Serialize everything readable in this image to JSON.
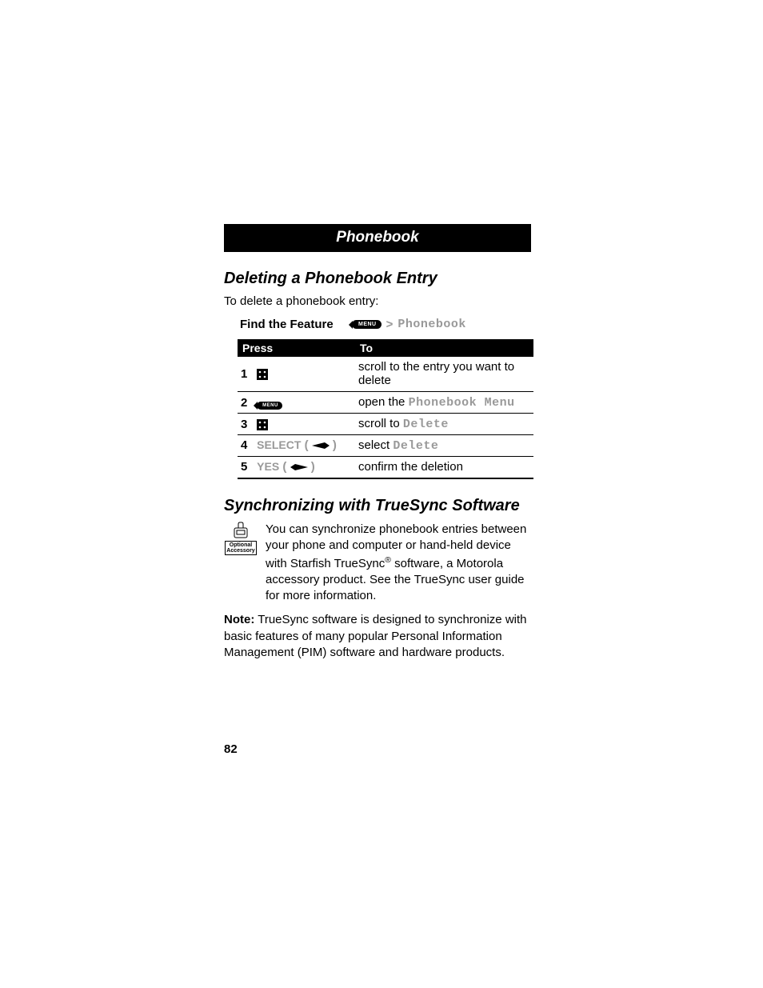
{
  "title_bar": "Phonebook",
  "section1": {
    "heading": "Deleting a Phonebook Entry",
    "intro": "To delete a phonebook entry:",
    "feature_label": "Find the Feature",
    "feature_key": "MENU",
    "feature_gt": ">",
    "feature_target": "Phonebook"
  },
  "table": {
    "headers": {
      "press": "Press",
      "to": "To"
    },
    "rows": [
      {
        "n": "1",
        "press_kind": "scroll",
        "to_pre": "scroll to the entry you want to delete",
        "to_mono": ""
      },
      {
        "n": "2",
        "press_kind": "menu",
        "press_label": "MENU",
        "to_pre": "open the ",
        "to_mono": "Phonebook Menu"
      },
      {
        "n": "3",
        "press_kind": "scroll",
        "to_pre": "scroll to ",
        "to_mono": "Delete"
      },
      {
        "n": "4",
        "press_kind": "soft-right",
        "press_label": "SELECT",
        "to_pre": "select ",
        "to_mono": "Delete"
      },
      {
        "n": "5",
        "press_kind": "soft-left",
        "press_label": "YES",
        "to_pre": "confirm the deletion",
        "to_mono": ""
      }
    ]
  },
  "section2": {
    "heading": "Synchronizing with TrueSync Software",
    "badge_line1": "Optional",
    "badge_line2": "Accessory",
    "para_a": "You can synchronize phonebook entries between your phone and computer or hand-held device with Starfish TrueSync",
    "reg": "®",
    "para_b": " software, a Motorola accessory product. See the TrueSync user guide for more information.",
    "note_label": "Note:",
    "note_body": " TrueSync software is designed to synchronize with basic features of many popular Personal Information Management (PIM) software and hardware products."
  },
  "page_number": "82"
}
